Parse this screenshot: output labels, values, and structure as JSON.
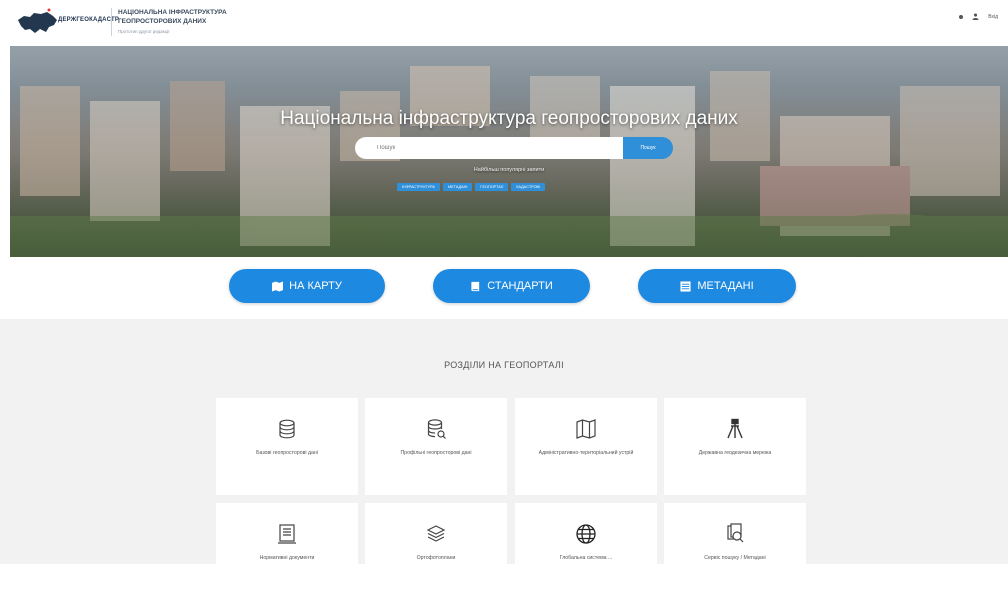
{
  "header": {
    "logo_text": "ДЕРЖГЕОКАДАСТР",
    "title_line1": "НАЦІОНАЛЬНА ІНФРАСТРУКТУРА",
    "title_line2": "ГЕОПРОСТОРОВИХ ДАНИХ",
    "subtitle": "Прототип другої редакції",
    "login_label": "Вхід"
  },
  "hero": {
    "title": "Національна інфраструктура геопросторових даних",
    "search_placeholder": "Пошук",
    "search_button": "Пошук",
    "popular_label": "Найбільш популярні запити",
    "tags": [
      "ІНФРАСТРУКТУРА",
      "МЕТАДАНІ",
      "ГЕОПОРТАЛ",
      "КАДАСТРОВІ"
    ]
  },
  "actions": {
    "map_label": "НА КАРТУ",
    "standards_label": "СТАНДАРТИ",
    "metadata_label": "МЕТАДАНІ"
  },
  "sections": {
    "title": "РОЗДІЛИ НА ГЕОПОРТАЛІ",
    "cards": [
      {
        "label": "Базові геопросторові дані",
        "icon": "database-icon"
      },
      {
        "label": "Профільні геопросторові дані",
        "icon": "database-search-icon"
      },
      {
        "label": "Адміністративно-територіальний устрій",
        "icon": "map-icon"
      },
      {
        "label": "Державна геодезична мережа",
        "icon": "tripod-icon"
      },
      {
        "label": "Нормативні документи",
        "icon": "document-icon"
      },
      {
        "label": "Ортофотоплани",
        "icon": "layers-icon"
      },
      {
        "label": "Глобальна система ...",
        "icon": "globe-icon"
      },
      {
        "label": "Сервіс пошуку / Метадані",
        "icon": "search-docs-icon"
      }
    ]
  },
  "colors": {
    "accent": "#1e89e0",
    "section_bg": "#f2f2f2"
  }
}
